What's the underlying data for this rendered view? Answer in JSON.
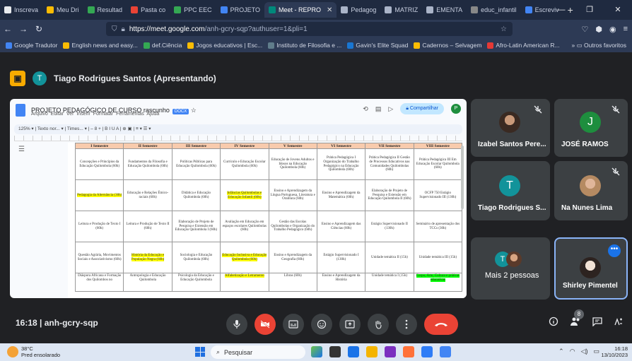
{
  "browser": {
    "tabs": [
      {
        "label": "Inscreva",
        "color": "#e8eaed"
      },
      {
        "label": "Meu Dri",
        "color": "#fbbc04"
      },
      {
        "label": "Resultad",
        "color": "#34a853"
      },
      {
        "label": "Pasta co",
        "color": "#ea4335"
      },
      {
        "label": "PPC EEC",
        "color": "#34a853"
      },
      {
        "label": "PROJETO",
        "color": "#4285f4"
      },
      {
        "label": "Meet - REPRO",
        "color": "#00897b"
      },
      {
        "label": "Pedagog",
        "color": "#aab4c8"
      },
      {
        "label": "MATRIZ",
        "color": "#aab4c8"
      },
      {
        "label": "EMENTA",
        "color": "#aab4c8"
      },
      {
        "label": "educ_infantil",
        "color": "#888"
      },
      {
        "label": "Escreviv",
        "color": "#4285f4"
      }
    ],
    "new_tab": "+",
    "url_host": "https://meet.google.com",
    "url_path": "/anh-gcry-sqp?authuser=1&pli=1",
    "bookmarks": [
      {
        "label": "Google Tradutor",
        "color": "#4285f4"
      },
      {
        "label": "English news and easy...",
        "color": "#fbbc04"
      },
      {
        "label": "def.Ciência",
        "color": "#34a853"
      },
      {
        "label": "Jogos educativos | Esc...",
        "color": "#fbbc04"
      },
      {
        "label": "Instituto de Filosofia e ...",
        "color": "#607d8b"
      },
      {
        "label": "Gavin's Elite Squad",
        "color": "#1976d2"
      },
      {
        "label": "Cadernos – Selvagem",
        "color": "#fbbc04"
      },
      {
        "label": "Afro-Latin American R...",
        "color": "#e53935"
      }
    ],
    "other_favorites": "Outros favoritos"
  },
  "meet": {
    "presenter_initial": "T",
    "presenter_label": "Tiago Rodrigues Santos (Apresentando)",
    "meeting_time": "16:18",
    "meeting_code": "anh-gcry-sqp",
    "participant_count": "8",
    "participants": [
      {
        "name": "Izabel Santos Pere...",
        "muted": true
      },
      {
        "name": "JOSÉ RAMOS",
        "initial": "J",
        "color": "#1e8e3e",
        "muted": true
      },
      {
        "name": "Tiago Rodrigues S...",
        "initial": "T",
        "color": "#12939a",
        "muted": false
      },
      {
        "name": "Na Nunes Lima",
        "muted": true
      },
      {
        "name": "Mais 2 pessoas",
        "initial": "T",
        "color": "#12939a"
      },
      {
        "name": "Shirley Pimentel",
        "muted": false
      }
    ]
  },
  "doc": {
    "title": "PROJETO PEDAGÓGICO DE CURSO rascunho",
    "badge": "DOCX",
    "menu": "Arquivo Editar Ver Inserir Formatar Ferramentas Ajuda",
    "share_label": "Compartilhar",
    "avatar_initial": "P",
    "toolbar": "125%  ▾  |  Texto nor...  ▾  |  Times...  ▾  |  –  8  +  |  B  I  U  A  |  ⊕  ▣  |  ≡  ▾  ☰  ▾",
    "headers": [
      "I Semestre",
      "II Semestre",
      "III Semestre",
      "IV Semestre",
      "V Semestre",
      "VI Semestre",
      "VII Semestre",
      "VIII Semestre"
    ],
    "rows": [
      {
        "cls": "r",
        "cells": [
          {
            "t": "Concepções e Princípios da Educação Quilombola (60h)"
          },
          {
            "t": "Fundamentos da Filosofia e Educação Quilombola (60h)"
          },
          {
            "t": "Políticas Públicas para Educação Quilombola (60h)"
          },
          {
            "t": "Currículo e Educação Escolar Quilombola (60h)"
          },
          {
            "t": "Educação de Jovens Adultos e Idosos na Educação Quilombola (60h)"
          },
          {
            "t": "Prática Pedagógica I Organização do Trabalho Pedagógico na Educação Quilombola (60h)"
          },
          {
            "t": "Prática Pedagógica II Gestão de Processos Educativos nas Comunidades Quilombolas (60h)"
          },
          {
            "t": "Prática Pedagógica III Em Educação Escolar Quilombola (60h)"
          }
        ]
      },
      {
        "cls": "r",
        "cells": [
          {
            "t": "Pedagogia da Alternância (30h)",
            "hl": "y"
          },
          {
            "t": "Educação e Relações Étnico-raciais (60h)"
          },
          {
            "t": "Didática e Educação Quilombola (60h)"
          },
          {
            "t": "Infâncias Quilombolas e Educação Infantil (60h)",
            "hl": "y"
          },
          {
            "t": "Ensino e Aprendizagem da Língua Portuguesa, Literatura e Oralitura (60h)"
          },
          {
            "t": "Ensino e Aprendizagem da Matemática (60h)"
          },
          {
            "t": "Elaboração de Projeto de Pesquisa e Extensão em Educação Quilombola II (60h)"
          },
          {
            "t": "OCFP 750 Estágio Supervisionado III (130h)"
          }
        ]
      },
      {
        "cls": "r",
        "cells": [
          {
            "t": "Leitura e Produção de Texto I (60h)"
          },
          {
            "t": "Leitura e Produção de Texto II (60h)"
          },
          {
            "t": "Elaboração de Projeto de Pesquisa e Extensão em Educação Quilombola I (60h)"
          },
          {
            "t": "Avaliação em Educação em espaços escolares Quilombolas (60h)"
          },
          {
            "t": "Gestão das Escolas Quilombolas e Organização do Trabalho Pedagógico (60h)"
          },
          {
            "t": "Ensino e Aprendizagem das Ciências (60h)"
          },
          {
            "t": "Estágio Supervisionado II (130h)"
          },
          {
            "t": "Seminário de apresentação dos TCCs (30h)"
          }
        ]
      },
      {
        "cls": "r",
        "cells": [
          {
            "t": "Questão Agrária, Movimentos Sociais e Associativismo (60h)"
          },
          {
            "t": "História da Educação e População Negra (60h)",
            "hl": "y"
          },
          {
            "t": "Sociologia e Educação Quilombola (60h)"
          },
          {
            "t": "Educação Inclusiva e Educação Quilombola (60h)",
            "hl": "y"
          },
          {
            "t": "Ensino e Aprendizagem da Geografia (60h)"
          },
          {
            "t": "Estágio Supervisionado I (130h)"
          },
          {
            "t": "Unidade temática II (15h)"
          },
          {
            "t": "Unidade temática III (15h)"
          }
        ]
      },
      {
        "cls": "rl",
        "cells": [
          {
            "t": "Diáspora Africana e Formação dos Quilombos no"
          },
          {
            "t": "Antropologia e Educação Quilombola"
          },
          {
            "t": "Psicologia da Educação e Educação Quilombola"
          },
          {
            "t": "Alfabetização e Letramento",
            "hl": "y"
          },
          {
            "t": "Libras (60h)"
          },
          {
            "t": "Ensino e Aprendizagem da História"
          },
          {
            "t": "Unidade temática I (15h)"
          },
          {
            "t": "Corpo, Arte, Cultura e práticas educativas",
            "hl": "g"
          }
        ]
      }
    ]
  },
  "taskbar": {
    "temp": "38°C",
    "weather": "Pred ensolarado",
    "search": "Pesquisar",
    "time": "16:18",
    "date": "13/10/2023"
  }
}
